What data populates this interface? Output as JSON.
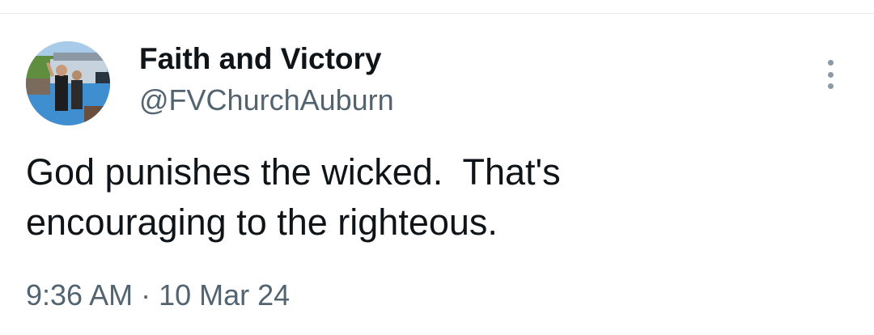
{
  "tweet": {
    "author": {
      "display_name": "Faith and Victory",
      "handle": "@FVChurchAuburn",
      "avatar_icon": "profile-photo"
    },
    "text_line1": "God punishes the wicked.  That's",
    "text_line2": "encouraging to the righteous.",
    "time": "9:36 AM",
    "separator": "·",
    "date": "10 Mar 24",
    "more_icon": "more-vertical-icon"
  },
  "colors": {
    "text_primary": "#0f1419",
    "text_secondary": "#536471",
    "divider": "#e6e9ec"
  }
}
